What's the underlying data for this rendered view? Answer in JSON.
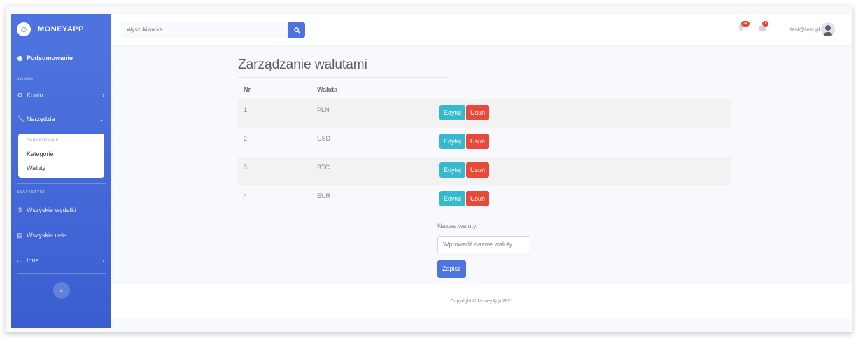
{
  "brand": {
    "name": "MONEYAPP",
    "icon": "laugh-wink-icon"
  },
  "sidebar": {
    "summary": "Podsumowanie",
    "heading_account": "KONTO",
    "account": "Konto",
    "tools": "Narzędzia",
    "tools_sub_heading": "ZARZĄDZANIE",
    "tools_sub_items": [
      "Kategorie",
      "Waluty"
    ],
    "heading_stats": "STATYSTYKI",
    "all_expenses": "Wszyskie wydatki",
    "all_goals": "Wszyskie cele",
    "other": "Inne",
    "toggle_icon": "chevron-left-icon"
  },
  "topbar": {
    "search_placeholder": "Wyszukiwarka",
    "alerts_badge": "3+",
    "messages_badge": "7",
    "user": "test@test.pl"
  },
  "main": {
    "title": "Zarządzanie walutami",
    "columns": [
      "Nr",
      "Waluta"
    ],
    "rows": [
      {
        "nr": "1",
        "currency": "PLN"
      },
      {
        "nr": "2",
        "currency": "USD"
      },
      {
        "nr": "3",
        "currency": "BTC"
      },
      {
        "nr": "4",
        "currency": "EUR"
      }
    ],
    "edit_label": "Edytuj",
    "delete_label": "Usuń",
    "form_label": "Nazwa waluty",
    "form_placeholder": "Wprowadź nazwę waluty",
    "save_label": "Zapisz"
  },
  "footer": {
    "copyright": "Copyright © MoneyApp 2021"
  },
  "colors": {
    "primary": "#4e73df",
    "info": "#36b9cc",
    "danger": "#e74a3b"
  }
}
